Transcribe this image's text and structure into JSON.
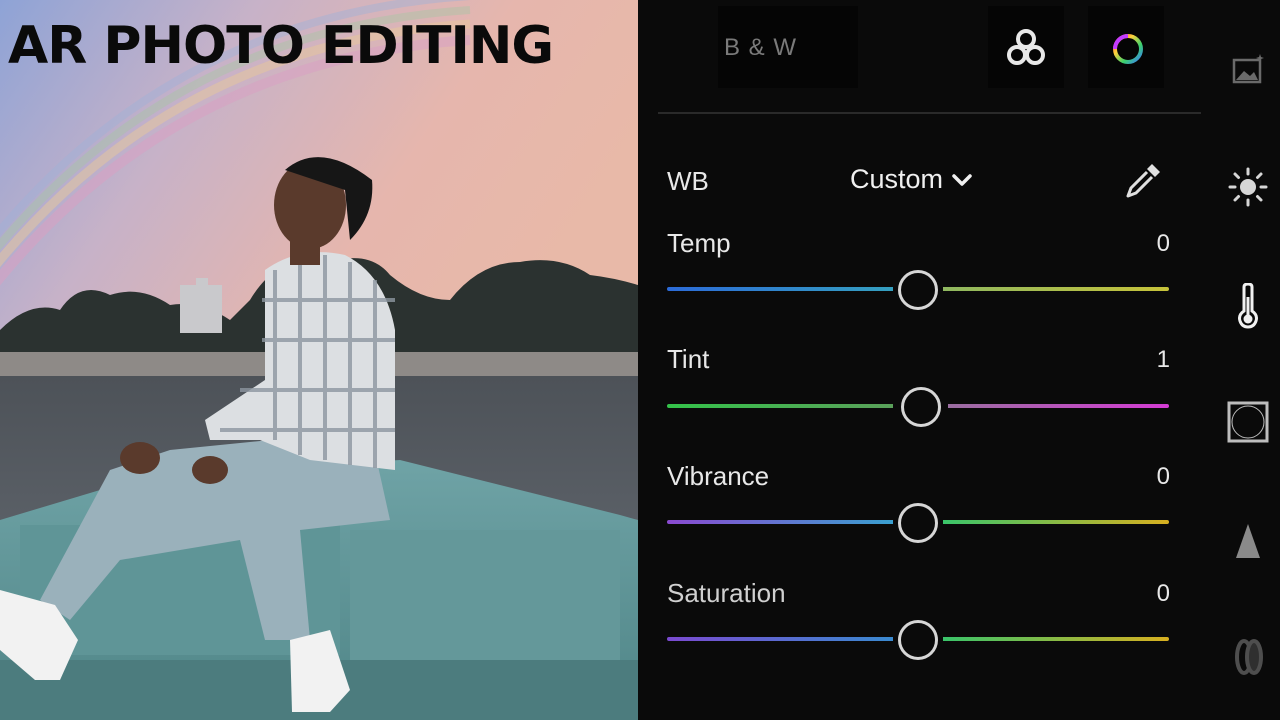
{
  "overlay": {
    "title": "AR PHOTO EDITING"
  },
  "panel": {
    "tabs": [
      {
        "label": "B & W",
        "icon": "bw-tab"
      },
      {
        "label": "",
        "icon": "color-mixer-icon"
      },
      {
        "label": "",
        "icon": "color-wheel-icon"
      }
    ],
    "wb": {
      "label": "WB",
      "value": "Custom",
      "dropdown_icon": "chevron-down-icon",
      "tool_icon": "eyedropper-icon"
    },
    "sliders": [
      {
        "label": "Temp",
        "value": "0",
        "level": 0.5
      },
      {
        "label": "Tint",
        "value": "1",
        "level": 0.505
      },
      {
        "label": "Vibrance",
        "value": "0",
        "level": 0.5
      },
      {
        "label": "Saturation",
        "value": "0",
        "level": 0.5
      }
    ],
    "side_tools": [
      "image-icon",
      "sun-icon",
      "thermometer-icon",
      "vignette-icon",
      "triangle-icon",
      "lens-icon"
    ]
  },
  "colors": {
    "panel_bg": "#0a0a0a",
    "knob": "#d6d6d6"
  }
}
